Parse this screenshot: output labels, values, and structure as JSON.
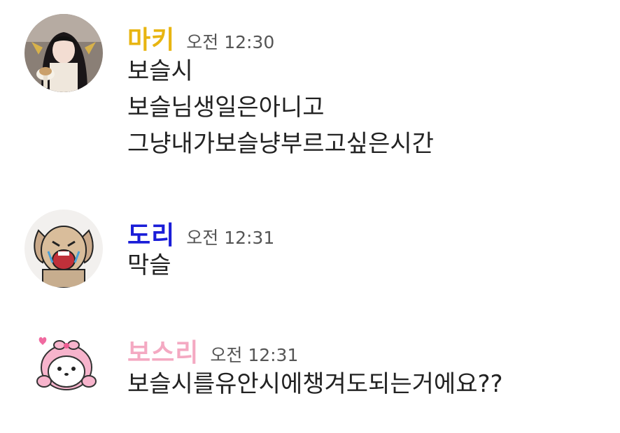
{
  "messages": [
    {
      "avatar": "avatar-girl-with-parfait",
      "name": "마키",
      "name_color": "#e8b511",
      "time": "오전 12:30",
      "lines": [
        "보슬시",
        "보슬님생일은아니고",
        "그냥내가보슬냥부르고싶은시간"
      ]
    },
    {
      "avatar": "avatar-cartoon-dog-crying",
      "name": "도리",
      "name_color": "#1a1dd8",
      "time": "오전 12:31",
      "lines": [
        "막슬"
      ]
    },
    {
      "avatar": "avatar-pink-hood-puppy",
      "name": "보스리",
      "name_color": "#f4a9c2",
      "time": "오전 12:31",
      "lines": [
        "보슬시를유안시에챙겨도되는거에요??"
      ]
    }
  ]
}
